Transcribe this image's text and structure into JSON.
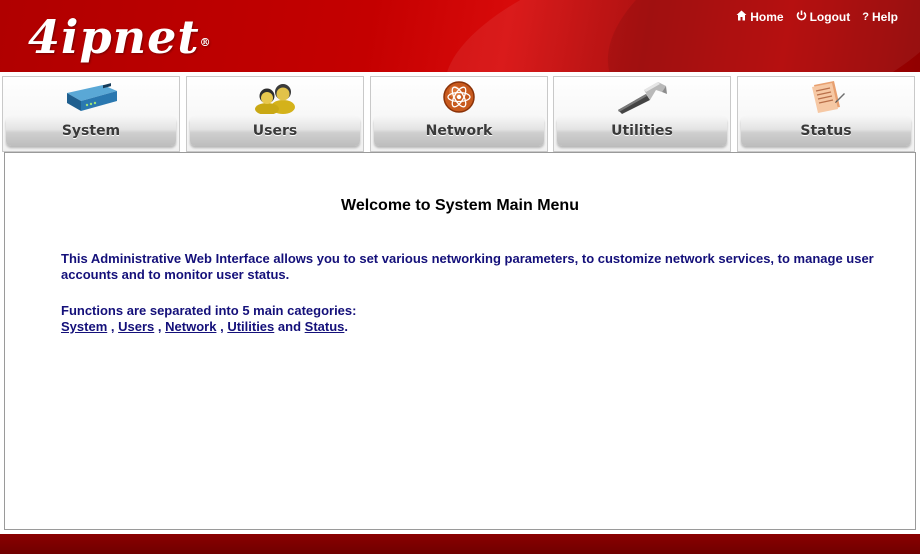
{
  "header": {
    "logo_text": "4ipnet",
    "logo_mark": "®",
    "links": {
      "home": "Home",
      "logout": "Logout",
      "help": "Help"
    },
    "brand_color": "#c00000"
  },
  "tabs": [
    {
      "label": "System",
      "icon": "router-device-icon"
    },
    {
      "label": "Users",
      "icon": "users-group-icon"
    },
    {
      "label": "Network",
      "icon": "network-globe-icon"
    },
    {
      "label": "Utilities",
      "icon": "hammer-icon"
    },
    {
      "label": "Status",
      "icon": "status-document-icon"
    }
  ],
  "content": {
    "title": "Welcome to System Main Menu",
    "description": "This Administrative Web Interface allows you to set various networking parameters, to customize network services, to manage user accounts and to monitor user status.",
    "functions_intro": "Functions are separated into 5 main categories:",
    "links": {
      "system": "System",
      "users": "Users",
      "network": "Network",
      "utilities": "Utilities",
      "status": "Status"
    },
    "sep": ",",
    "and": "and",
    "end": ".",
    "text_color": "#14107a"
  }
}
